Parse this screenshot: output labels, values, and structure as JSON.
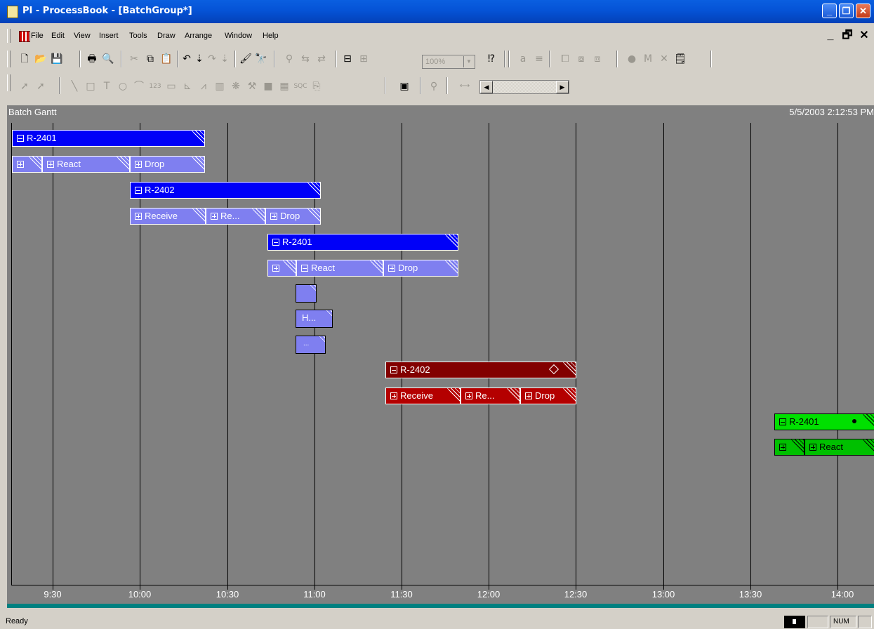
{
  "window": {
    "title": "PI - ProcessBook - [BatchGroup*]"
  },
  "menu": [
    "File",
    "Edit",
    "View",
    "Insert",
    "Tools",
    "Draw",
    "Arrange",
    "Window",
    "Help"
  ],
  "toolbar": {
    "zoom": "100%"
  },
  "gantt": {
    "title": "Batch Gantt",
    "timestamp": "5/5/2003 2:12:53 PM",
    "ticks": [
      "9:30",
      "10:00",
      "10:30",
      "11:00",
      "11:30",
      "12:00",
      "12:30",
      "13:00",
      "13:30",
      "14:00"
    ],
    "colors": {
      "blue": "#0000f8",
      "lightblue": "#7f7ff0",
      "darkred": "#820000",
      "red": "#b40000",
      "green": "#00e000"
    },
    "rows": {
      "r1": {
        "unit": "R-2401",
        "ops": [
          "",
          "React",
          "Drop"
        ]
      },
      "r2": {
        "unit": "R-2402",
        "ops": [
          "Receive",
          "Re...",
          "Drop"
        ]
      },
      "r3": {
        "unit": "R-2401",
        "ops": [
          "",
          "React",
          "Drop"
        ],
        "phases": [
          "",
          "H...",
          "..."
        ]
      },
      "r4": {
        "unit": "R-2402",
        "ops": [
          "Receive",
          "Re...",
          "Drop"
        ]
      },
      "r5": {
        "unit": "R-2401",
        "ops": [
          "",
          "React"
        ]
      }
    }
  },
  "status": {
    "text": "Ready",
    "num": "NUM"
  }
}
